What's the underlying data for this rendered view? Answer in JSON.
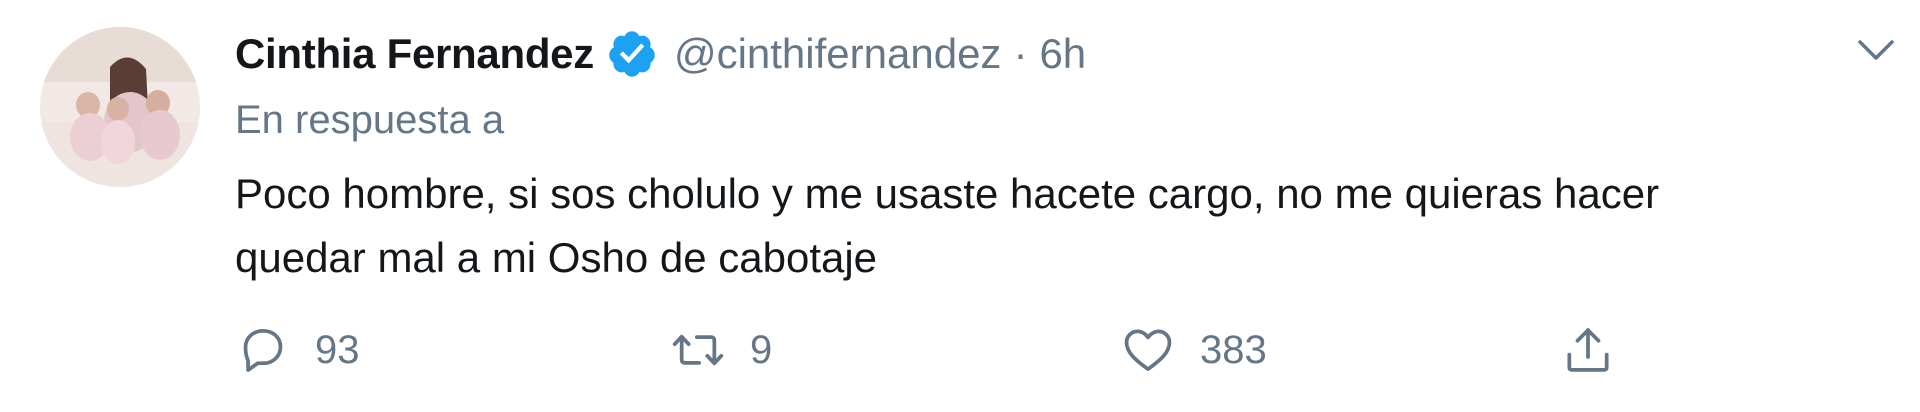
{
  "tweet": {
    "author": {
      "display_name": "Cinthia Fernandez",
      "handle": "@cinthifernandez",
      "verified": true
    },
    "separator": "·",
    "timestamp": "6h",
    "reply_context": "En respuesta a",
    "text": "Poco hombre, si sos cholulo y me usaste hacete cargo, no me quieras hacer\nquedar mal a mi Osho de cabotaje",
    "actions": {
      "reply_count": "93",
      "retweet_count": "9",
      "like_count": "383"
    }
  },
  "icons": {
    "verified": "verified-badge-icon",
    "menu": "chevron-down-icon",
    "reply": "reply-icon",
    "retweet": "retweet-icon",
    "like": "heart-icon",
    "share": "share-icon"
  },
  "colors": {
    "text": "#14171a",
    "secondary": "#657786",
    "verified": "#1da1f2"
  }
}
